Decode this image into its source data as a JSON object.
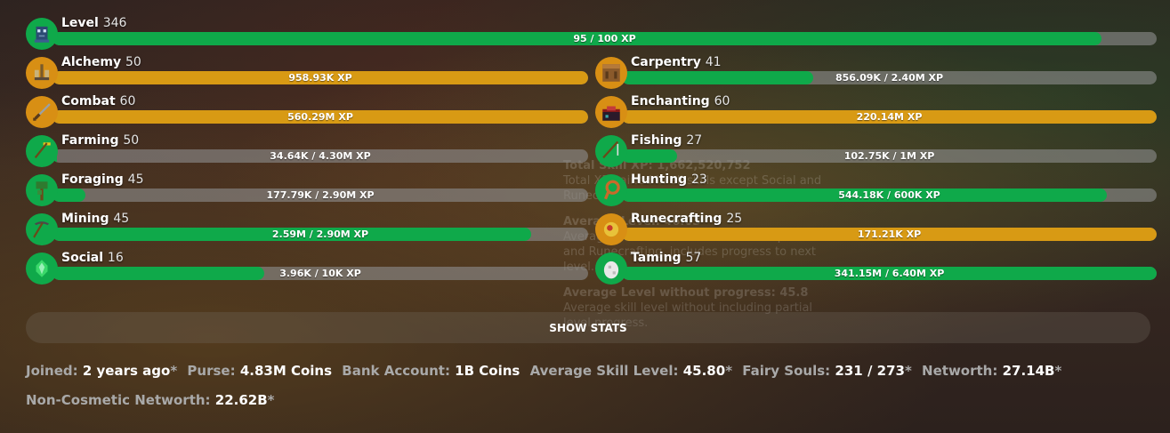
{
  "level": {
    "name": "Level",
    "value": "346",
    "xp": "95 / 100 XP",
    "progress": 0.95,
    "icon": "player-avatar-icon"
  },
  "skills": [
    {
      "name": "Alchemy",
      "level": "50",
      "xp": "958.93K XP",
      "progress": 1.0,
      "maxed": true,
      "icon": "brewing-stand-icon"
    },
    {
      "name": "Carpentry",
      "level": "41",
      "xp": "856.09K / 2.40M XP",
      "progress": 0.357,
      "maxed": false,
      "icon": "crafting-table-icon"
    },
    {
      "name": "Combat",
      "level": "60",
      "xp": "560.29M XP",
      "progress": 1.0,
      "maxed": true,
      "icon": "sword-icon"
    },
    {
      "name": "Enchanting",
      "level": "60",
      "xp": "220.14M XP",
      "progress": 1.0,
      "maxed": true,
      "icon": "enchanting-table-icon"
    },
    {
      "name": "Farming",
      "level": "50",
      "xp": "34.64K / 4.30M XP",
      "progress": 0.008,
      "maxed": false,
      "icon": "hoe-icon"
    },
    {
      "name": "Fishing",
      "level": "27",
      "xp": "102.75K / 1M XP",
      "progress": 0.103,
      "maxed": false,
      "icon": "fishing-rod-icon"
    },
    {
      "name": "Foraging",
      "level": "45",
      "xp": "177.79K / 2.90M XP",
      "progress": 0.061,
      "maxed": false,
      "icon": "sapling-icon"
    },
    {
      "name": "Hunting",
      "level": "23",
      "xp": "544.18K / 600K XP",
      "progress": 0.907,
      "maxed": false,
      "icon": "lasso-icon"
    },
    {
      "name": "Mining",
      "level": "45",
      "xp": "2.59M / 2.90M XP",
      "progress": 0.893,
      "maxed": false,
      "icon": "pickaxe-icon"
    },
    {
      "name": "Runecrafting",
      "level": "25",
      "xp": "171.21K XP",
      "progress": 1.0,
      "maxed": true,
      "icon": "rune-orb-icon"
    },
    {
      "name": "Social",
      "level": "16",
      "xp": "3.96K / 10K XP",
      "progress": 0.396,
      "maxed": false,
      "icon": "emerald-icon"
    },
    {
      "name": "Taming",
      "level": "57",
      "xp": "341.15M / 6.40M XP",
      "progress": 1.0,
      "maxed": false,
      "icon": "spawn-egg-icon"
    }
  ],
  "tooltip": {
    "total_title": "Total Skill XP: 1,662,520,752",
    "total_desc": "Total XP gained in all skills except Social and Runecrafting.",
    "avg_title": "Average Level: 46.03",
    "avg_desc": "Average skill level over all skills except Social and Runecrafting, includes progress to next level.",
    "avg_np_title": "Average Level without progress: 45.8",
    "avg_np_desc": "Average skill level without including partial level progress."
  },
  "show_stats_label": "SHOW STATS",
  "stats": {
    "joined_label": "Joined:",
    "joined_value": "2 years ago",
    "purse_label": "Purse:",
    "purse_value": "4.83M Coins",
    "bank_label": "Bank Account:",
    "bank_value": "1B Coins",
    "avg_label": "Average Skill Level:",
    "avg_value": "45.80",
    "souls_label": "Fairy Souls:",
    "souls_value": "231 / 273",
    "networth_label": "Networth:",
    "networth_value": "27.14B",
    "noncos_label": "Non-Cosmetic Networth:",
    "noncos_value": "22.62B",
    "asterisk": "*"
  },
  "colors": {
    "green": "#0fa94a",
    "gold": "#d89a14",
    "track": "#8c8c8c"
  }
}
